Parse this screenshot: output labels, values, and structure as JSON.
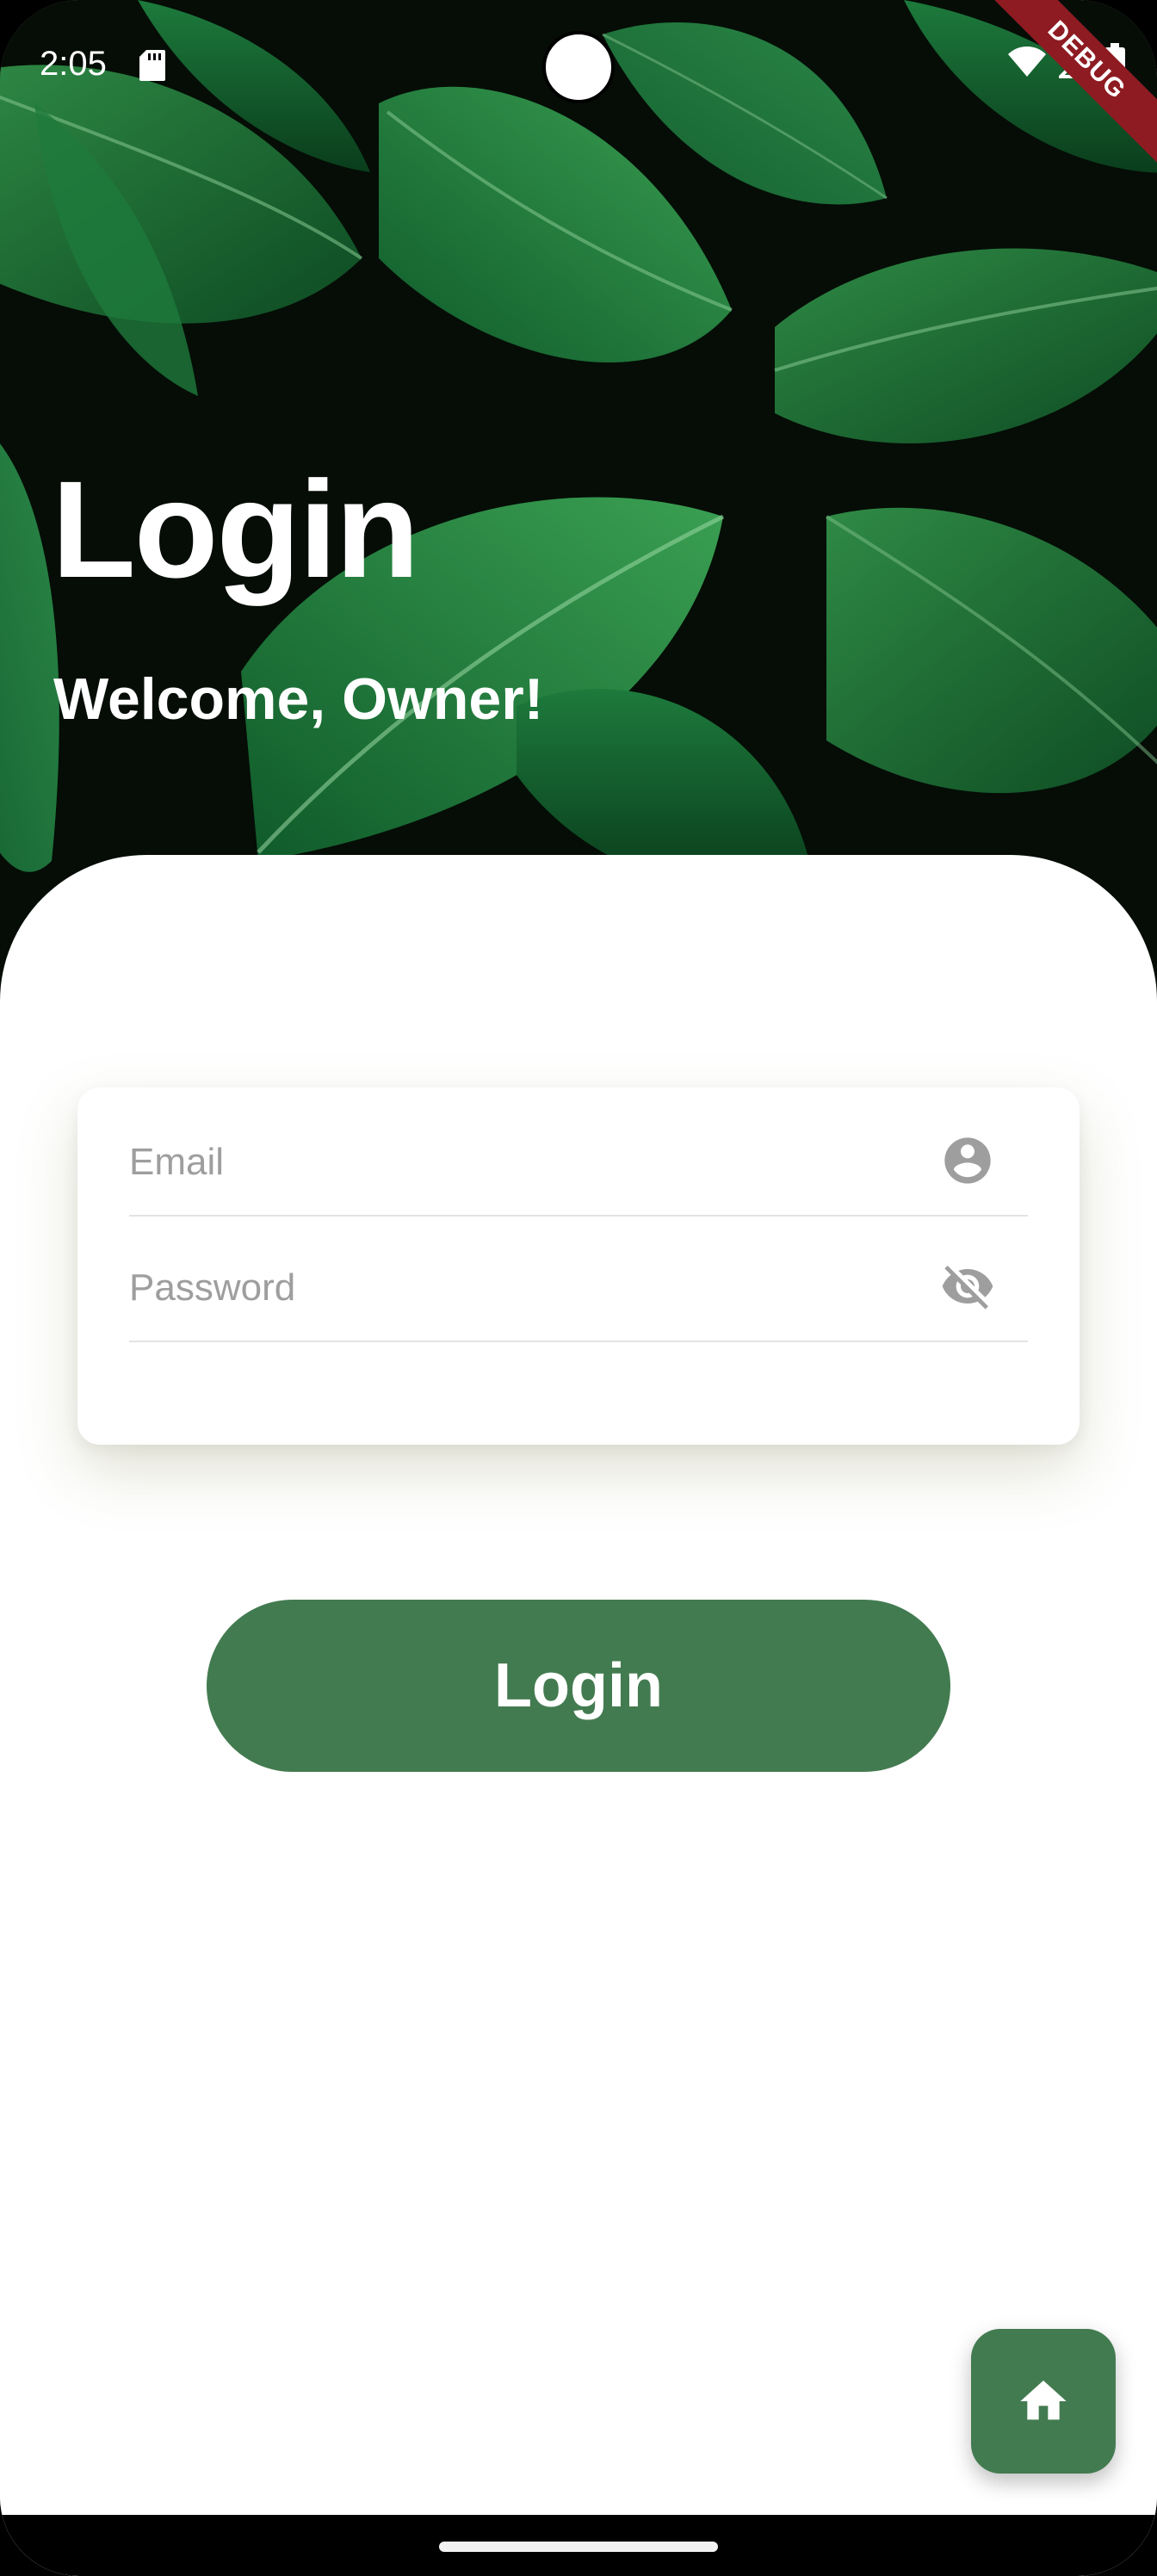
{
  "status_bar": {
    "time": "2:05",
    "debug_label": "DEBUG"
  },
  "header": {
    "title": "Login",
    "subtitle": "Welcome, Owner!"
  },
  "form": {
    "email": {
      "placeholder": "Email",
      "value": "",
      "icon": "account-circle-icon"
    },
    "password": {
      "placeholder": "Password",
      "value": "",
      "icon": "visibility-off-icon"
    }
  },
  "actions": {
    "login_label": "Login",
    "fab_icon": "home-icon"
  },
  "colors": {
    "accent": "#437b50",
    "debug_banner": "#8e1b22"
  }
}
